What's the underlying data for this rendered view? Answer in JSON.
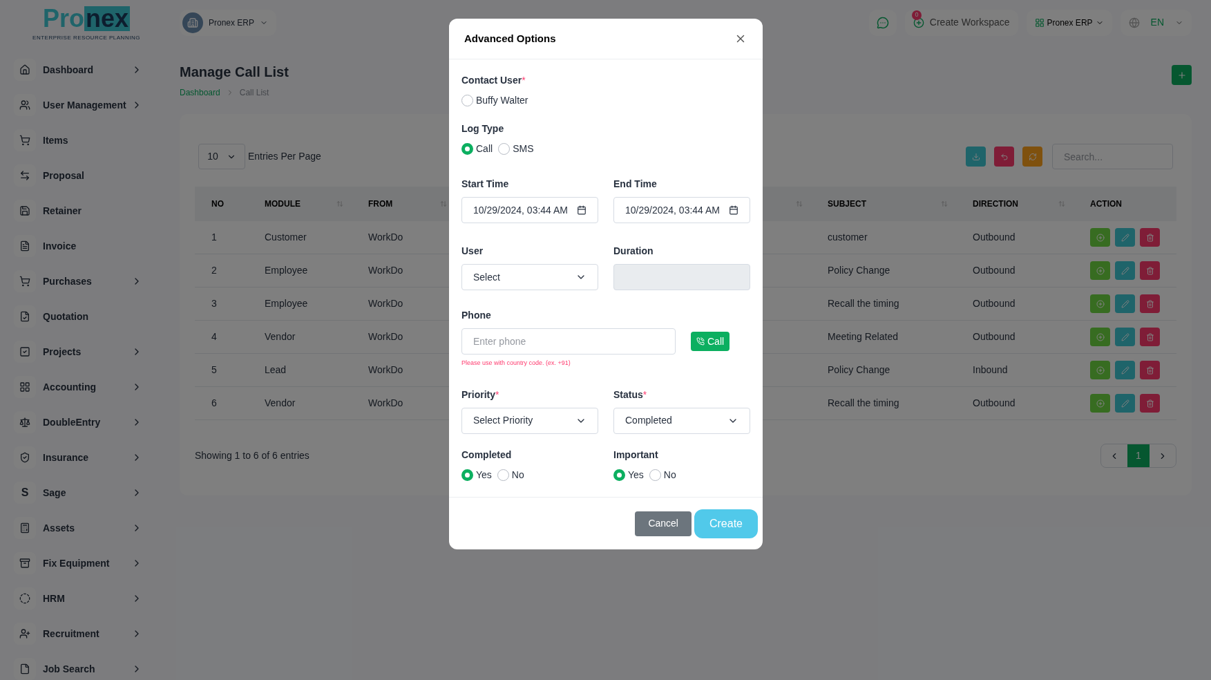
{
  "logo": {
    "text_start": "Pro",
    "text_end": "nex",
    "tagline": "ENTERPRISE RESOURCE PLANNING"
  },
  "header": {
    "workspace": "Pronex ERP",
    "notification_count": "0",
    "create_workspace": "Create Workspace",
    "app_switcher": "Pronex ERP",
    "language": "EN"
  },
  "sidebar": {
    "items": [
      {
        "label": "Dashboard",
        "has_submenu": true
      },
      {
        "label": "User Management",
        "has_submenu": true
      },
      {
        "label": "Items",
        "has_submenu": false
      },
      {
        "label": "Proposal",
        "has_submenu": false
      },
      {
        "label": "Retainer",
        "has_submenu": false
      },
      {
        "label": "Invoice",
        "has_submenu": false
      },
      {
        "label": "Purchases",
        "has_submenu": true
      },
      {
        "label": "Quotation",
        "has_submenu": false
      },
      {
        "label": "Projects",
        "has_submenu": true
      },
      {
        "label": "Accounting",
        "has_submenu": true
      },
      {
        "label": "DoubleEntry",
        "has_submenu": true
      },
      {
        "label": "Insurance",
        "has_submenu": true
      },
      {
        "label": "Sage",
        "has_submenu": true,
        "icon_text": "S"
      },
      {
        "label": "Assets",
        "has_submenu": true
      },
      {
        "label": "Fix Equipment",
        "has_submenu": true
      },
      {
        "label": "HRM",
        "has_submenu": true
      },
      {
        "label": "Recruitment",
        "has_submenu": true
      },
      {
        "label": "Job Search",
        "has_submenu": true
      }
    ]
  },
  "page": {
    "title": "Manage Call List",
    "breadcrumb": [
      {
        "label": "Dashboard",
        "link": true
      },
      {
        "label": "Call List",
        "link": false
      }
    ]
  },
  "table": {
    "entries_value": "10",
    "entries_label": "Entries Per Page",
    "search_placeholder": "Search...",
    "columns": [
      {
        "label": "NO",
        "sortable": false
      },
      {
        "label": "MODULE",
        "sortable": true
      },
      {
        "label": "FROM",
        "sortable": true
      },
      {
        "label": "SUBJECT",
        "sortable": true
      },
      {
        "label": "DIRECTION",
        "sortable": true
      },
      {
        "label": "ACTION",
        "sortable": false
      }
    ],
    "rows": [
      {
        "no": "1",
        "module": "Customer",
        "from": "WorkDo",
        "subject": "customer",
        "direction": "Outbound"
      },
      {
        "no": "2",
        "module": "Employee",
        "from": "WorkDo",
        "subject": "Policy Change",
        "direction": "Outbound"
      },
      {
        "no": "3",
        "module": "Employee",
        "from": "WorkDo",
        "subject": "Recall the timing",
        "direction": "Outbound"
      },
      {
        "no": "4",
        "module": "Vendor",
        "from": "WorkDo",
        "subject": "Meeting Related",
        "direction": "Outbound"
      },
      {
        "no": "5",
        "module": "Lead",
        "from": "WorkDo",
        "subject": "Policy Change",
        "direction": "Inbound"
      },
      {
        "no": "6",
        "module": "Vendor",
        "from": "WorkDo",
        "subject": "Recall the timing",
        "direction": "Outbound"
      }
    ],
    "footer": "Showing 1 to 6 of 6 entries",
    "pages": [
      {
        "label": "1",
        "selected": true
      }
    ]
  },
  "modal": {
    "title": "Advanced Options",
    "contact_user": {
      "label": "Contact User",
      "required_mark": "*",
      "options": [
        {
          "label": "Buffy Walter",
          "selected": false
        }
      ]
    },
    "log_type": {
      "label": "Log Type",
      "options": [
        {
          "label": "Call",
          "selected": true
        },
        {
          "label": "SMS",
          "selected": false
        }
      ]
    },
    "start_time": {
      "label": "Start Time",
      "value": "10/29/2024, 03:44 AM"
    },
    "end_time": {
      "label": "End Time",
      "value": "10/29/2024, 03:44 AM"
    },
    "user": {
      "label": "User",
      "value": "Select"
    },
    "duration": {
      "label": "Duration",
      "disabled": true
    },
    "phone": {
      "label": "Phone",
      "placeholder": "Enter phone",
      "hint": "Please use with country code. (ex. +91)",
      "call_button": "Call"
    },
    "priority": {
      "label": "Priority",
      "required_mark": "*",
      "value": "Select Priority"
    },
    "status": {
      "label": "Status",
      "required_mark": "*",
      "value": "Completed"
    },
    "completed": {
      "label": "Completed",
      "options": [
        {
          "label": "Yes",
          "selected": true
        },
        {
          "label": "No",
          "selected": false
        }
      ]
    },
    "important": {
      "label": "Important",
      "options": [
        {
          "label": "Yes",
          "selected": true
        },
        {
          "label": "No",
          "selected": false
        }
      ]
    },
    "cancel_button": "Cancel",
    "create_button": "Create"
  }
}
